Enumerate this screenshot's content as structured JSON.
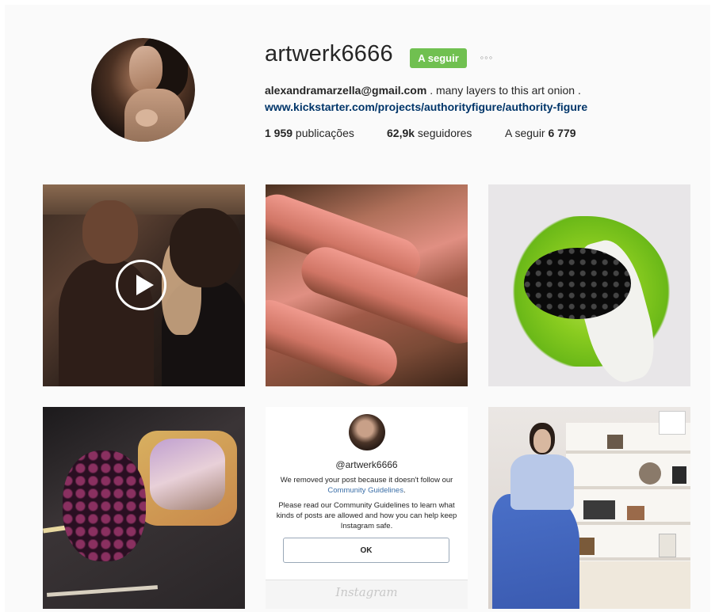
{
  "profile": {
    "username": "artwerk6666",
    "follow_label": "A seguir",
    "more_label": "◦◦◦",
    "bio_email": "alexandramarzella@gmail.com",
    "bio_text": " . many layers to this art onion .",
    "bio_link": "www.kickstarter.com/projects/authorityfigure/authority-figure"
  },
  "stats": {
    "posts_count": "1 959",
    "posts_label": " publicações",
    "followers_count": "62,9k",
    "followers_label": " seguidores",
    "following_label": "A seguir ",
    "following_count": "6 779"
  },
  "removed_post": {
    "handle": "@artwerk6666",
    "message_prefix": "We removed your post because it doesn't follow our",
    "guidelines_link": "Community Guidelines",
    "message_suffix": ".",
    "details": "Please read our Community Guidelines to learn what kinds of posts are allowed and how you can help keep Instagram safe.",
    "ok_label": "OK",
    "brand": "Instagram"
  },
  "icons": {
    "play": "play-icon",
    "more": "more-options-icon"
  },
  "colors": {
    "follow_button": "#70c050",
    "link": "#003569",
    "background": "#fafafa"
  }
}
